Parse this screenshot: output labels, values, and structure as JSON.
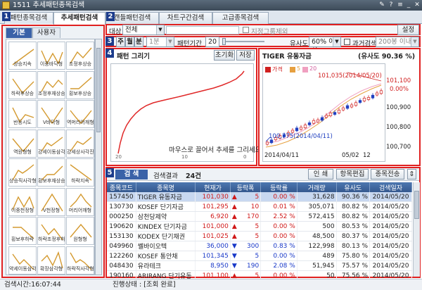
{
  "window": {
    "title": "1511 추세패턴종목검색"
  },
  "main_tabs": [
    {
      "label": "패턴종목검색"
    },
    {
      "label": "추세패턴검색"
    },
    {
      "label": "캔들패턴검색"
    },
    {
      "label": "차트구간검색"
    },
    {
      "label": "고급종목검색"
    }
  ],
  "badges": [
    "1",
    "2",
    "3",
    "4",
    "5"
  ],
  "left_tabs": {
    "basic": "기본",
    "user": "사용자"
  },
  "patterns": [
    "상승지속",
    "이중바닥형",
    "조정후상승",
    "하락후상승",
    "조정후재상승",
    "횡보후상승",
    "반등시도",
    "V바닥형",
    "역머리어깨형",
    "역원형형",
    "강세이동삼각",
    "강세상사각진형",
    "상승직사각형",
    "횡보후재상승",
    "하락지속",
    "이중천정형",
    "V천정형",
    "머리어깨형",
    "횡보후하락",
    "하락조정후하락",
    "원형형",
    "약세이동삼각",
    "확장삼각형",
    "하락직사각형"
  ],
  "condition": {
    "target_label": "대상",
    "target_value": "전체",
    "exclude_group": "지정그룹제외",
    "settings_btn": "설정",
    "period_tabs": [
      "주",
      "월",
      "분"
    ],
    "minute_value": "1분",
    "pattern_period_label": "패턴기간",
    "pattern_period_value": "20",
    "similarity_label": "유사도",
    "similarity_value": "60% 이상",
    "past_search_label": "과거검색",
    "past_search_value": "200봉 이내"
  },
  "draw_panel": {
    "title": "패턴 그리기",
    "reset_btn": "초기화",
    "save_btn": "저장",
    "hint": "마우스로 끌어서 추세를 그리세요",
    "x_ticks": [
      "20",
      "10",
      "0"
    ]
  },
  "preview": {
    "name": "TIGER 유동자금",
    "similarity_label": "(유사도 90.36 %)",
    "legend_price": "가격",
    "legend_ma5": "5",
    "legend_ma20": "20",
    "high_note": "101,035(2014/05/20)",
    "low_note": "100,775(2014/04/11)",
    "right_axis": [
      "101,100",
      "0.00%",
      "100,900",
      "100,800",
      "100,700"
    ],
    "x_ticks": [
      "2014/04/11",
      "05/02",
      "12"
    ]
  },
  "results": {
    "tab_label": "검    색",
    "result_label": "검색결과",
    "count": "24건",
    "print_btn": "인  쇄",
    "edit_btn": "항목편집",
    "send_btn": "종목전송",
    "columns": [
      "종목코드",
      "종목명",
      "현재가",
      "등락폭",
      "등락률",
      "거래량",
      "유사도",
      "검색일자"
    ],
    "rows": [
      {
        "code": "157450",
        "name": "TIGER 유동자금",
        "price": "101,030",
        "dir": "▲",
        "change": "5",
        "rate": "0.00 %",
        "volume": "31,628",
        "sim": "90.36 %",
        "date": "2014/05/20",
        "color": "red"
      },
      {
        "code": "130730",
        "name": "KOSEF 단기자금",
        "price": "101,295",
        "dir": "▲",
        "change": "10",
        "rate": "0.01 %",
        "volume": "305,071",
        "sim": "80.82 %",
        "date": "2014/05/20",
        "color": "red"
      },
      {
        "code": "000250",
        "name": "삼천당제약",
        "price": "6,920",
        "dir": "▲",
        "change": "170",
        "rate": "2.52 %",
        "volume": "572,415",
        "sim": "80.82 %",
        "date": "2014/05/20",
        "color": "red"
      },
      {
        "code": "190620",
        "name": "KINDEX 단기자금",
        "price": "101,000",
        "dir": "▲",
        "change": "5",
        "rate": "0.00 %",
        "volume": "500",
        "sim": "80.53 %",
        "date": "2014/05/20",
        "color": "red"
      },
      {
        "code": "153130",
        "name": "KODEX 단기채권",
        "price": "101,025",
        "dir": "▲",
        "change": "5",
        "rate": "0.00 %",
        "volume": "48,500",
        "sim": "80.37 %",
        "date": "2014/05/20",
        "color": "red"
      },
      {
        "code": "049960",
        "name": "쎌바이오텍",
        "price": "36,000",
        "dir": "▼",
        "change": "300",
        "rate": "0.83 %",
        "volume": "122,998",
        "sim": "80.13 %",
        "date": "2014/05/20",
        "color": "blue"
      },
      {
        "code": "122260",
        "name": "KOSEF 통안채",
        "price": "101,345",
        "dir": "▼",
        "change": "5",
        "rate": "0.00 %",
        "volume": "489",
        "sim": "75.80 %",
        "date": "2014/05/20",
        "color": "blue"
      },
      {
        "code": "048430",
        "name": "유라테크",
        "price": "8,950",
        "dir": "▼",
        "change": "190",
        "rate": "2.08 %",
        "volume": "51,945",
        "sim": "75.57 %",
        "date": "2014/05/20",
        "color": "blue"
      },
      {
        "code": "190160",
        "name": "ARIRANG 단기유동",
        "price": "101,100",
        "dir": "▲",
        "change": "5",
        "rate": "0.00 %",
        "volume": "50",
        "sim": "75.56 %",
        "date": "2014/05/20",
        "color": "red"
      }
    ]
  },
  "status": {
    "search_time": "검색시간:16:07:44",
    "progress_label": "진행상태 : [조회 완료]"
  }
}
